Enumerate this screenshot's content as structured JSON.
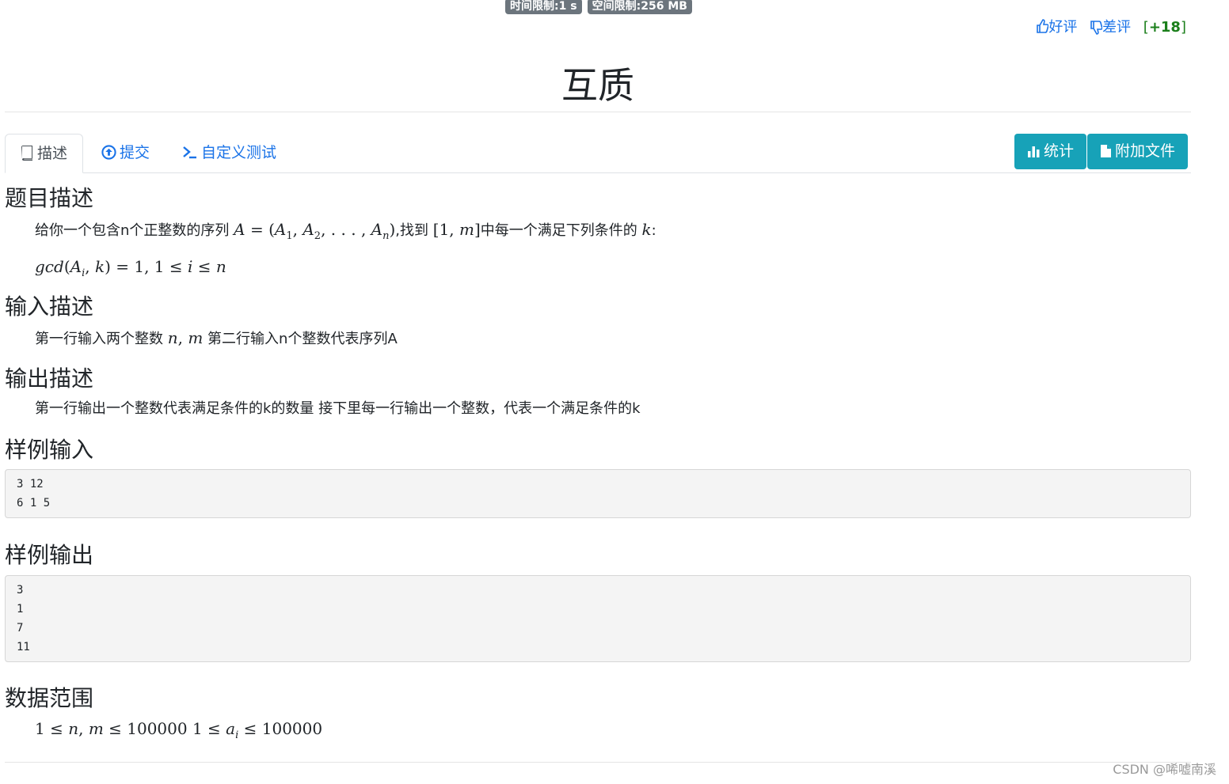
{
  "limits": {
    "time": "时间限制:1 s",
    "memory": "空间限制:256 MB"
  },
  "rating": {
    "good": "好评",
    "bad": "差评",
    "score_open": "[",
    "score": "+18",
    "score_close": "]"
  },
  "title": "互质",
  "tabs": [
    {
      "label": "描述",
      "icon": "book-icon"
    },
    {
      "label": "提交",
      "icon": "upload-circle-icon"
    },
    {
      "label": "自定义测试",
      "icon": "terminal-icon"
    }
  ],
  "buttons": [
    {
      "label": "统计",
      "icon": "bar-chart-icon"
    },
    {
      "label": "附加文件",
      "icon": "file-icon"
    }
  ],
  "sections": {
    "description": {
      "heading": "题目描述",
      "line1_prefix": "给你一个包含n个正整数的序列",
      "line1_mid": ",找到",
      "line1_mid2": "中每一个满足下列条件的",
      "line1_suffix": ":"
    },
    "input": {
      "heading": "输入描述",
      "text_prefix": "第一行输入两个整数",
      "text_suffix": "第二行输入n个整数代表序列A"
    },
    "output": {
      "heading": "输出描述",
      "text": "第一行输出一个整数代表满足条件的k的数量 接下里每一行输出一个整数，代表一个满足条件的k"
    },
    "sample_input": {
      "heading": "样例输入",
      "content": "3 12\n6 1 5"
    },
    "sample_output": {
      "heading": "样例输出",
      "content": "3\n1\n7\n11"
    },
    "range": {
      "heading": "数据范围"
    }
  },
  "watermark": "CSDN @唏嘘南溪"
}
